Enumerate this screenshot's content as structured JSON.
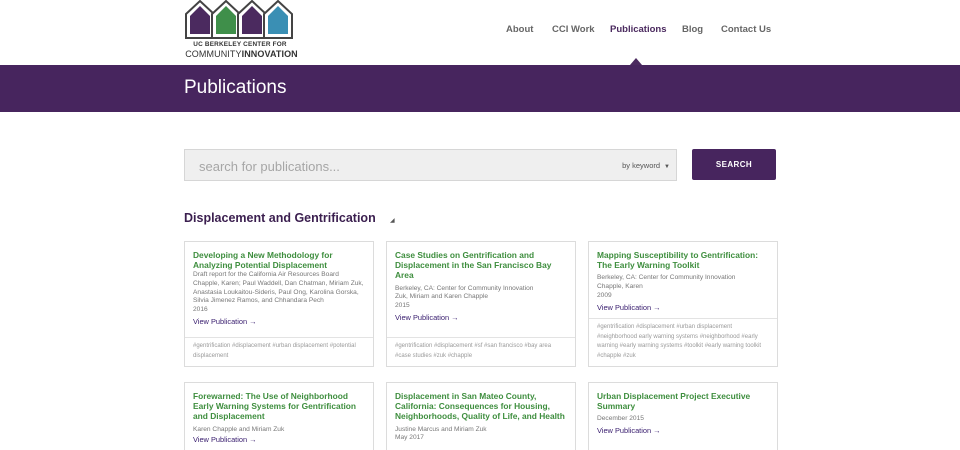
{
  "logo": {
    "line1": "UC BERKELEY CENTER FOR",
    "line2_a": "COMMUNITY",
    "line2_b": "INNOVATION",
    "house_colors": [
      "#4b2a5f",
      "#3f8f4a",
      "#4b2a5f",
      "#3a8fb4"
    ]
  },
  "nav": {
    "items": [
      {
        "label": "About"
      },
      {
        "label": "CCI Work"
      },
      {
        "label": "Publications"
      },
      {
        "label": "Blog"
      },
      {
        "label": "Contact Us"
      }
    ],
    "active": "Publications"
  },
  "band": {
    "title": "Publications"
  },
  "search": {
    "placeholder": "search for publications...",
    "mode": "by keyword",
    "button_label": "SEARCH"
  },
  "section": {
    "title": "Displacement and Gentrification"
  },
  "cards": [
    {
      "title": "Developing a New Methodology for Analyzing Potential Displacement",
      "meta": [
        "Draft report for the California Air Resources Board",
        "Chapple, Karen; Paul Waddell, Dan Chatman, Miriam Zuk, Anastasia Loukaitou-Sideris, Paul Ong, Karolina Gorska, Silvia Jimenez Ramos, and Chhandara Pech",
        "2016"
      ],
      "link": "View Publication →",
      "tags": "#gentrification #displacement #urban displacement #potential displacement"
    },
    {
      "title": "Case Studies on Gentrification and Displacement in the San Francisco Bay Area",
      "meta": [
        "Berkeley, CA: Center for Community Innovation",
        "Zuk, Miriam and Karen Chapple",
        "2015"
      ],
      "link": "View Publication →",
      "tags": "#gentrification #displacement #sf #san francisco #bay area #case studies #zuk #chapple"
    },
    {
      "title": "Mapping Susceptibility to Gentrification: The Early Warning Toolkit",
      "meta": [
        "Berkeley, CA: Center for Community Innovation",
        "Chapple, Karen",
        "2009"
      ],
      "link": "View Publication →",
      "tags": "#gentrification #displacement #urban displacement #neighborhood early warning systems #neighborhood #early warning #early warning systems #toolkit #early warning toolkit #chapple #zuk"
    },
    {
      "title": "Forewarned: The Use of Neighborhood Early Warning Systems for Gentrification and Displacement",
      "meta": [
        "Karen Chapple and Miriam Zuk"
      ],
      "link": "View Publication →",
      "tags": ""
    },
    {
      "title": "Displacement in San Mateo County, California: Consequences for Housing, Neighborhoods, Quality of Life, and Health",
      "meta": [
        "Justine Marcus and Miriam Zuk",
        "May 2017"
      ],
      "link": "",
      "tags": ""
    },
    {
      "title": "Urban Displacement Project Executive Summary",
      "meta": [
        "December 2015"
      ],
      "link": "View Publication →",
      "tags": ""
    }
  ]
}
